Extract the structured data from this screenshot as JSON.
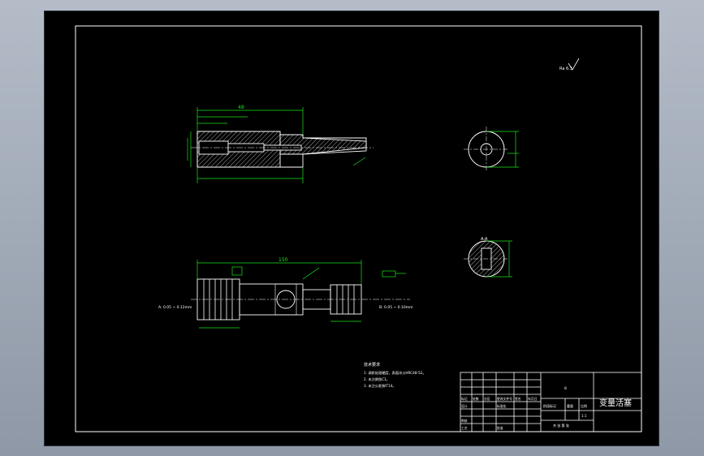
{
  "title_block": {
    "part_name": "变量活塞",
    "top_mark": "8",
    "scale_label": "比例",
    "scale_value": "1:1",
    "stage_label": "阶段标记",
    "weight_label": "重量",
    "sheet_label": "共 张 第 张",
    "labels": [
      "标记",
      "处数",
      "分区",
      "更改文件号",
      "签名",
      "年月日"
    ],
    "designer": "设计",
    "standard": "标准化",
    "reviewer": "审核",
    "process": "工艺",
    "approve": "批准"
  },
  "technical_requirements": {
    "title": "技术要求",
    "lines": [
      "1. 调质处理硬度，表面淬火HRC48-52。",
      "2. 未注倒角C1。",
      "3. 未注公差按IT14。"
    ]
  },
  "roughness_mark": "Ra 6.3",
  "dimensions": {
    "top_overall": "48",
    "bottom_overall": "150",
    "note_left": "A: 0.05 ~ 0.12mm",
    "note_right": "B: 0.05 ~ 0.10mm",
    "section_a": "A-A"
  },
  "colors": {
    "line": "#ffffff",
    "dim": "#19e619",
    "section": "#e8e8e8"
  }
}
